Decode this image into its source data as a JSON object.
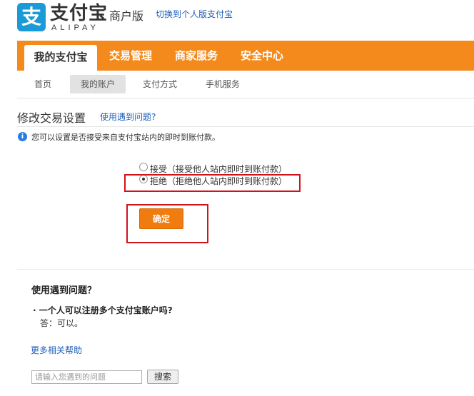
{
  "header": {
    "logo_glyph": "支",
    "logo_cn": "支付宝",
    "logo_en": "ALIPAY",
    "merchant_label": "商户版",
    "switch_link": "切换到个人版支付宝"
  },
  "topnav": {
    "tabs": [
      {
        "label": "我的支付宝",
        "active": true
      },
      {
        "label": "交易管理",
        "active": false
      },
      {
        "label": "商家服务",
        "active": false
      },
      {
        "label": "安全中心",
        "active": false
      }
    ]
  },
  "subnav": {
    "items": [
      {
        "label": "首页",
        "active": false
      },
      {
        "label": "我的账户",
        "active": true
      },
      {
        "label": "支付方式",
        "active": false
      },
      {
        "label": "手机服务",
        "active": false
      }
    ]
  },
  "page": {
    "title": "修改交易设置",
    "help_link": "使用遇到问题?",
    "info_icon": "info-icon",
    "info_text": "您可以设置是否接受来自支付宝站内的即时到账付款。"
  },
  "form": {
    "options": [
      {
        "label": "接受（接受他人站内即时到账付款）",
        "checked": false
      },
      {
        "label": "拒绝（拒绝他人站内即时到账付款）",
        "checked": true
      }
    ],
    "confirm_label": "确定"
  },
  "faq": {
    "title": "使用遇到问题？",
    "question": "· 一个人可以注册多个支付宝账户吗?",
    "answer": "答：可以。",
    "more_link": "更多相关帮助"
  },
  "search": {
    "placeholder": "请输入您遇到的问题",
    "button_label": "搜索"
  },
  "colors": {
    "brand_blue": "#1a9bd8",
    "nav_orange": "#f48a1c",
    "button_orange": "#f07c10",
    "highlight_red": "#d0121b",
    "link_blue": "#1e5fb8"
  }
}
